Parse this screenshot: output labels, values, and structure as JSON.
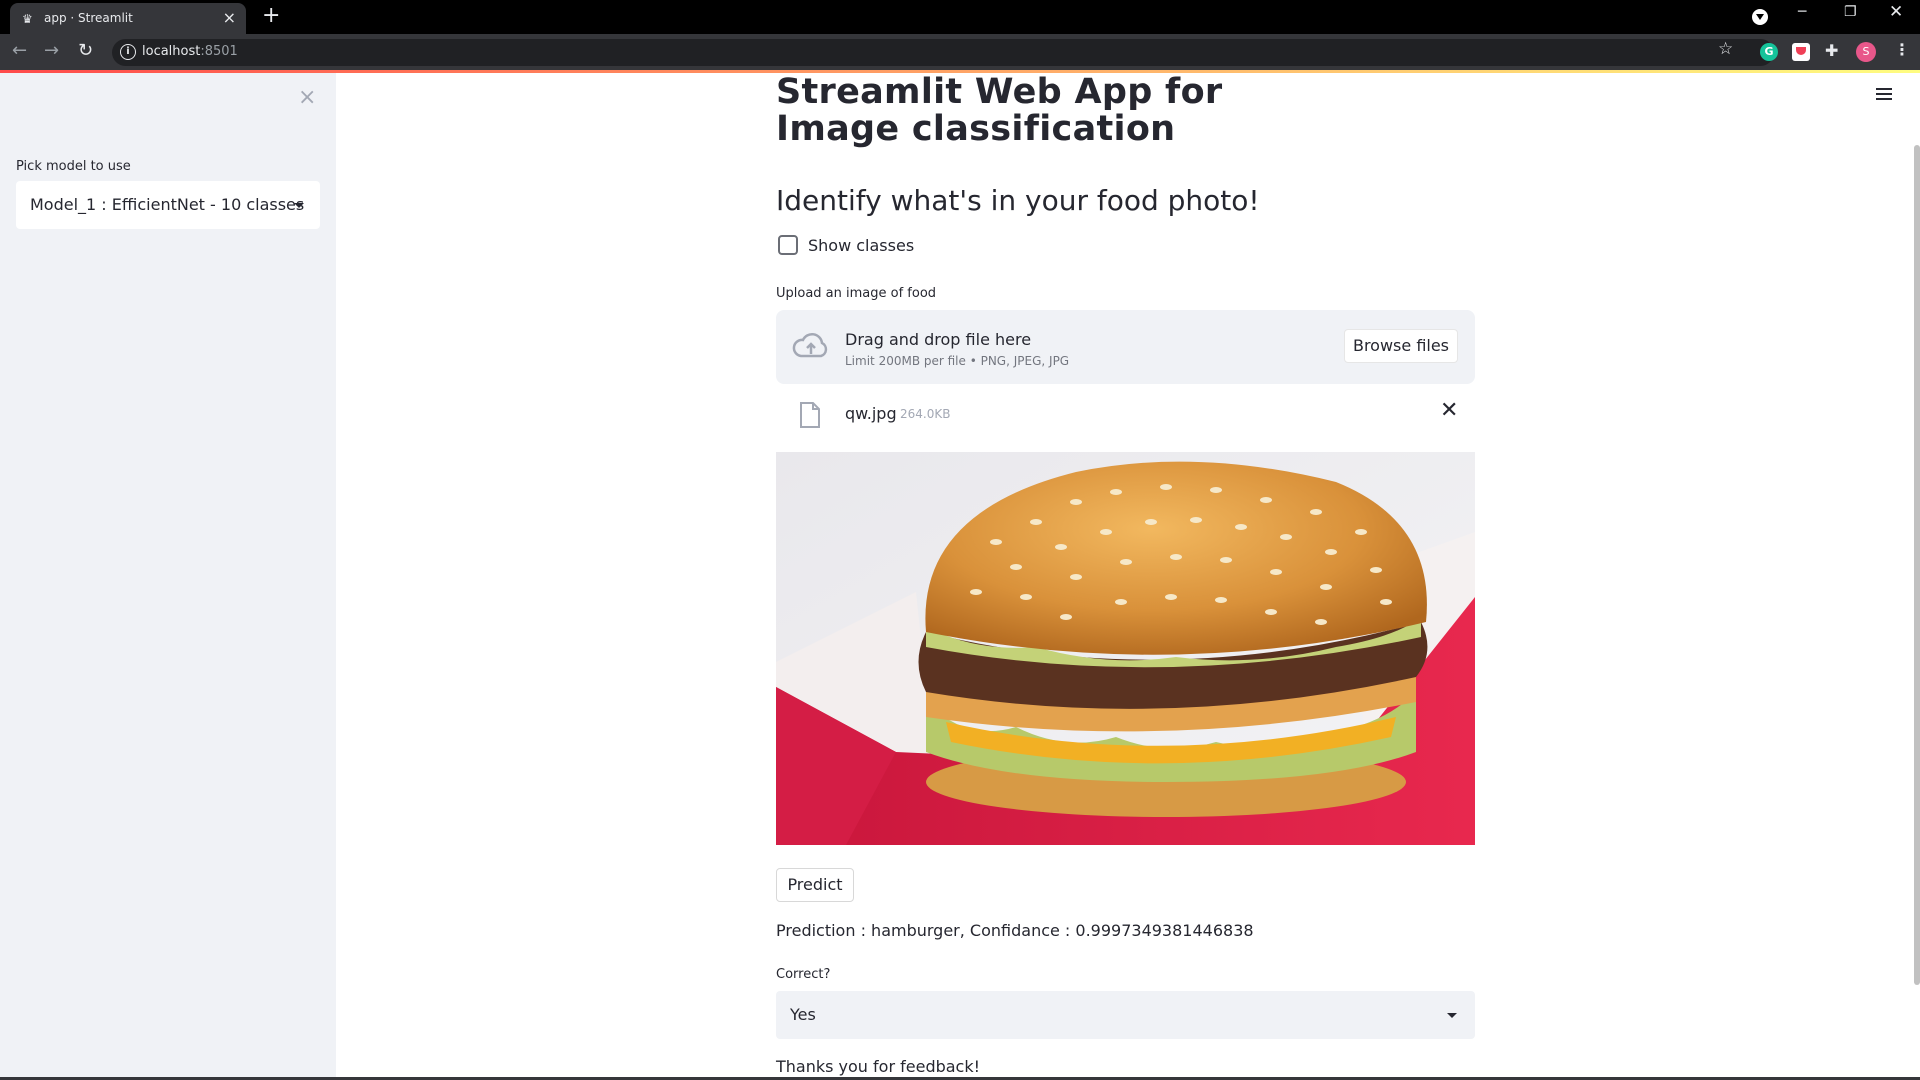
{
  "browser": {
    "tab_title": "app · Streamlit",
    "url_host": "localhost",
    "url_port": ":8501",
    "profile_initial": "S",
    "grammarly_letter": "G"
  },
  "sidebar": {
    "model_label": "Pick model to use",
    "model_selected": "Model_1 : EfficientNet - 10 classes"
  },
  "main": {
    "title": "Streamlit Web App for Image classification",
    "subheader": "Identify what's in your food photo!",
    "show_classes_label": "Show classes",
    "show_classes_checked": false,
    "upload_label": "Upload an image of food",
    "dropzone_title": "Drag and drop file here",
    "dropzone_limits": "Limit 200MB per file • PNG, JPEG, JPG",
    "browse_label": "Browse files",
    "file_name": "qw.jpg",
    "file_size": "264.0KB",
    "predict_label": "Predict",
    "prediction_text": "Prediction : hamburger, Confidance : 0.9997349381446838",
    "correct_label": "Correct?",
    "correct_selected": "Yes",
    "thanks_text": "Thanks you for feedback!"
  },
  "colors": {
    "accent": "#ff4b4b",
    "sidebar_bg": "#f0f2f6",
    "text": "#262730"
  }
}
